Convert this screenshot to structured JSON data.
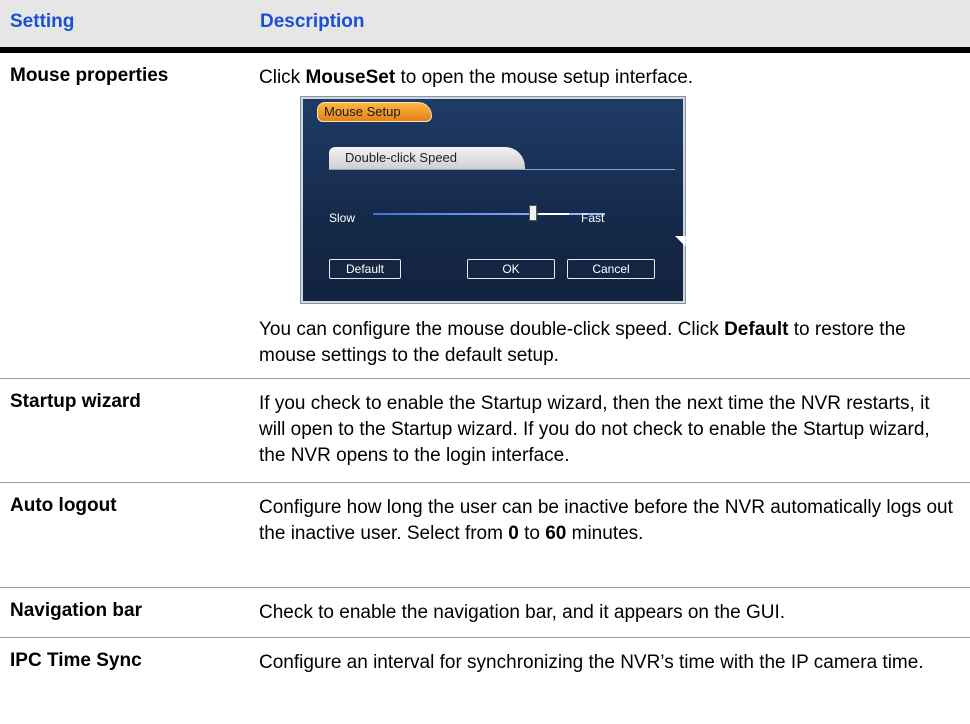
{
  "header": {
    "setting": "Setting",
    "description": "Description"
  },
  "rows": [
    {
      "setting": "Mouse properties",
      "desc_pre": "Click ",
      "desc_bold": "MouseSet",
      "desc_post": " to open the mouse setup interface.",
      "after_pre": "You can configure the mouse double-click speed. Click ",
      "after_bold": "Default",
      "after_post": " to restore the mouse settings to the default setup."
    },
    {
      "setting": "Startup wizard",
      "desc": "If you check to enable the Startup wizard, then the next time the NVR restarts, it will open to the Startup wizard. If you do not check to enable the Startup wizard, the NVR opens to the login interface."
    },
    {
      "setting": "Auto logout",
      "desc_pre": "Configure how long the user can be inactive before the NVR automatically logs out the inactive user. Select from ",
      "b1": "0",
      "mid": " to ",
      "b2": "60",
      "desc_post": " minutes."
    },
    {
      "setting": "Navigation bar",
      "desc": "Check to enable the navigation bar, and it appears on the GUI."
    },
    {
      "setting": "IPC Time Sync",
      "desc": "Configure an interval for synchronizing the NVR’s time with the IP camera time."
    }
  ],
  "dialog": {
    "title": "Mouse Setup",
    "tab": "Double-click Speed",
    "slow": "Slow",
    "fast": "Fast",
    "speed": 0.78,
    "default_btn": "Default",
    "ok_btn": "OK",
    "cancel_btn": "Cancel"
  }
}
